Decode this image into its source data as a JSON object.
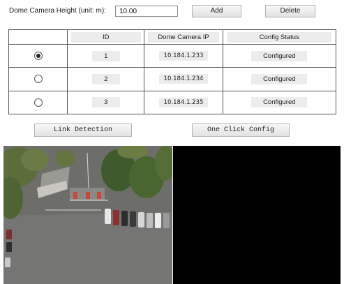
{
  "settings": {
    "height_label": "Dome Camera Height (unit: m):",
    "height_value": "10.00",
    "add_label": "Add",
    "delete_label": "Delete"
  },
  "table": {
    "headers": [
      "",
      "ID",
      "Dome Camera IP",
      "Config Status"
    ],
    "rows": [
      {
        "selected": true,
        "id": "1",
        "ip": "10.184.1.233",
        "status": "Configured"
      },
      {
        "selected": false,
        "id": "2",
        "ip": "10.184.1.234",
        "status": "Configured"
      },
      {
        "selected": false,
        "id": "3",
        "ip": "10.184.1.235",
        "status": "Configured"
      }
    ]
  },
  "actions": {
    "link_detection": "Link Detection",
    "one_click_config": "One Click Config"
  },
  "video": {
    "left_panel": "camera-feed-aerial-parking-lot",
    "right_panel": "empty-black-feed"
  }
}
